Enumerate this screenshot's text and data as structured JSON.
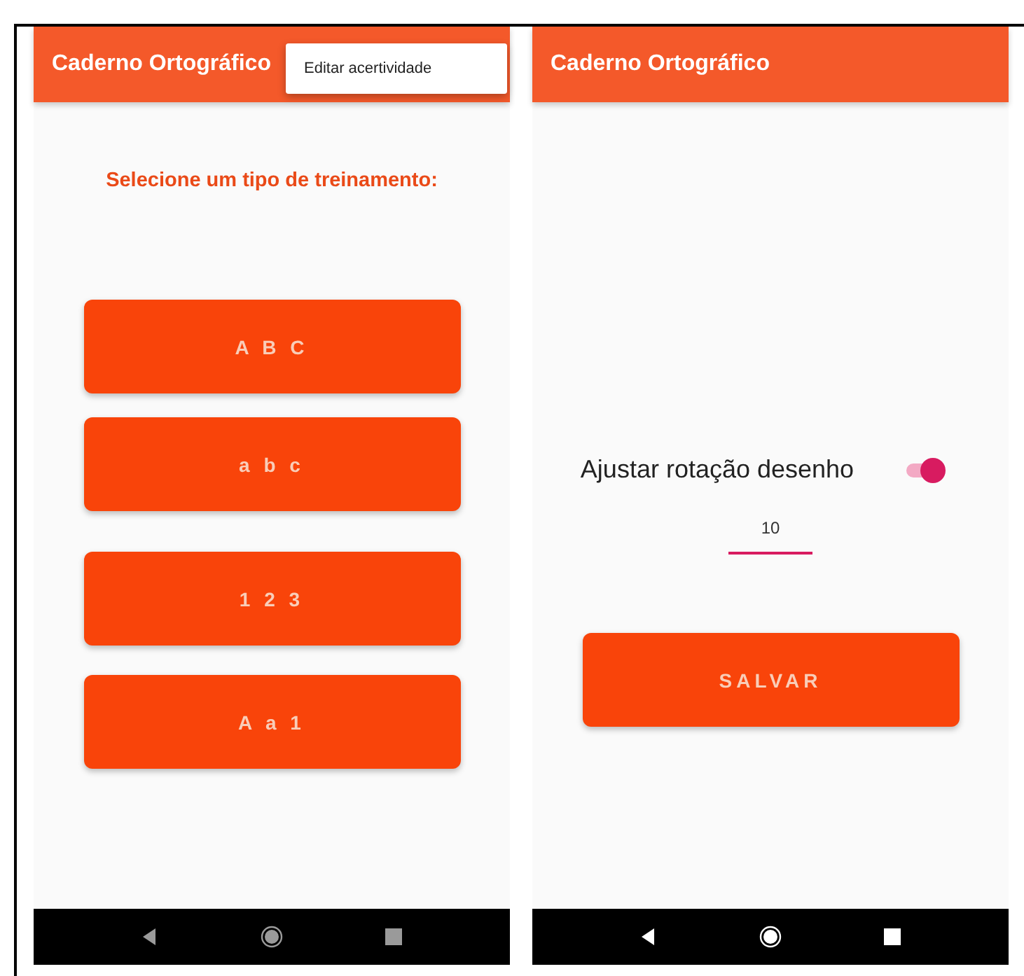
{
  "screens": [
    {
      "app_bar": {
        "title": "Caderno Ortográfico"
      },
      "menu": {
        "items": [
          "Editar acertividade"
        ]
      },
      "heading": "Selecione um tipo de treinamento:",
      "buttons": [
        "A B C",
        "a b c",
        "1 2 3",
        "A a 1"
      ],
      "nav_dimmed": true
    },
    {
      "app_bar": {
        "title": "Caderno Ortográfico"
      },
      "setting": {
        "label": "Ajustar rotação desenho",
        "on": true
      },
      "field": {
        "value": "10"
      },
      "save_button": "SALVAR",
      "nav_dimmed": false
    }
  ]
}
